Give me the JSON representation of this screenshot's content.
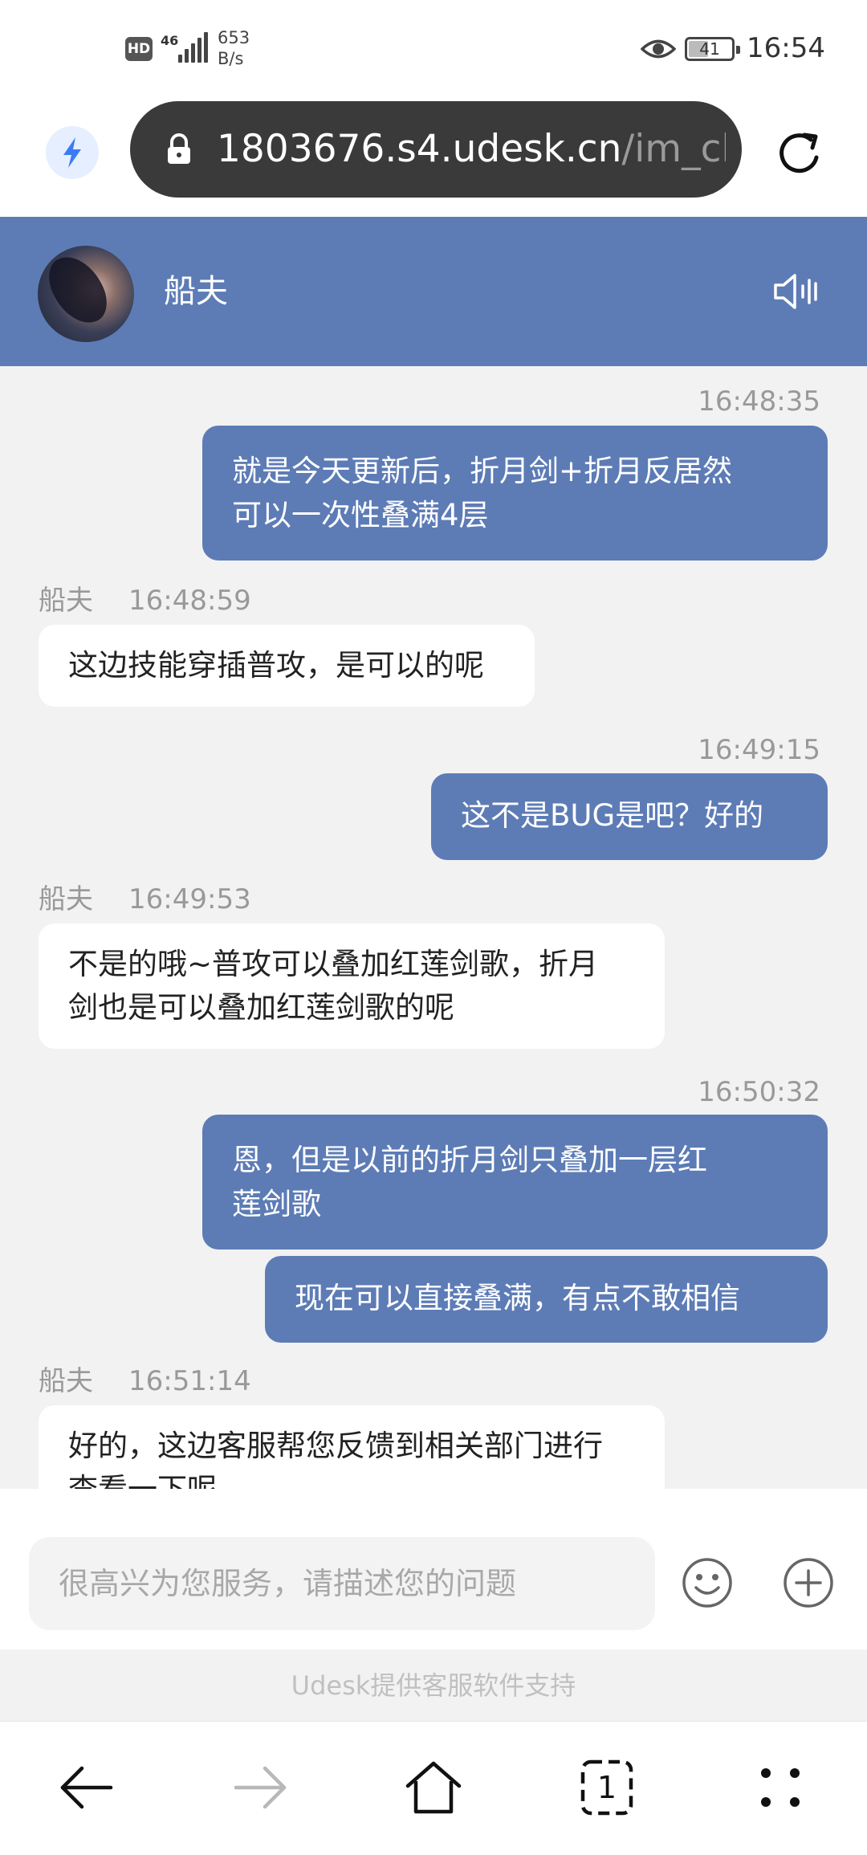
{
  "status_bar": {
    "hd": "HD",
    "network": "46",
    "speed_value": "653",
    "speed_unit": "B/s",
    "battery": "41",
    "time": "16:54"
  },
  "browser": {
    "url_host": "1803676.s4.udesk.cn",
    "url_path": "/im_clier"
  },
  "chat_header": {
    "agent_name": "船夫"
  },
  "messages": [
    {
      "time": "16:48:35",
      "text_1": "就是今天更新后，折月剑+折月反居然",
      "text_2": "可以一次性叠满4层"
    },
    {
      "sender": "船夫",
      "time": "16:48:59",
      "text": "这边技能穿插普攻，是可以的呢"
    },
    {
      "time": "16:49:15",
      "text": "这不是BUG是吧？好的"
    },
    {
      "sender": "船夫",
      "time": "16:49:53",
      "text_1": "不是的哦~普攻可以叠加红莲剑歌，折月",
      "text_2": "剑也是可以叠加红莲剑歌的呢"
    },
    {
      "time": "16:50:32",
      "text_1": "恩，但是以前的折月剑只叠加一层红",
      "text_2": "莲剑歌"
    },
    {
      "text": "现在可以直接叠满，有点不敢相信"
    },
    {
      "sender": "船夫",
      "time": "16:51:14",
      "text_1": "好的，这边客服帮您反馈到相关部门进行",
      "text_2": "查看一下呢"
    }
  ],
  "input": {
    "placeholder": "很高兴为您服务，请描述您的问题",
    "value": ""
  },
  "footer": {
    "credit": "Udesk提供客服软件支持"
  },
  "bottom_nav": {
    "tab_count": "1"
  },
  "colors": {
    "accent": "#5d7cb6",
    "chat_background": "#f2f2f2",
    "url_bar": "#3a3a3a"
  }
}
